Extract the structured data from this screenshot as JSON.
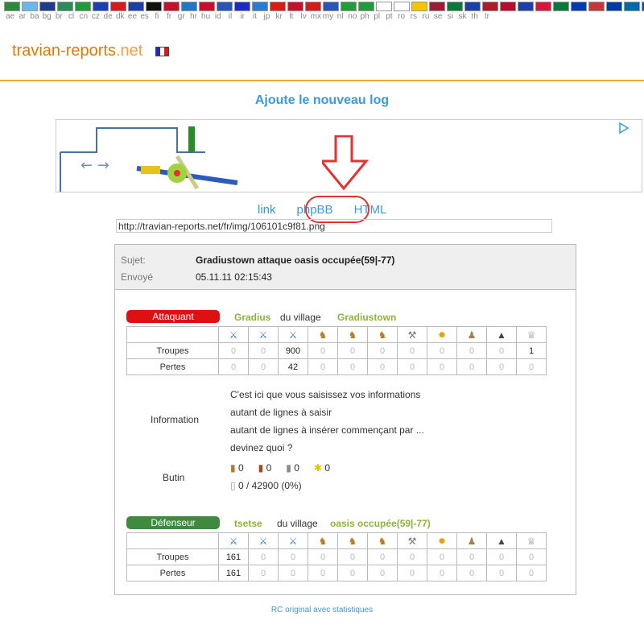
{
  "flags": {
    "codes": [
      "ae",
      "ar",
      "ba",
      "bg",
      "br",
      "cl",
      "cn",
      "cz",
      "de",
      "dk",
      "ee",
      "es",
      "fi",
      "fr",
      "gr",
      "hr",
      "hu",
      "id",
      "il",
      "ir",
      "it",
      "jp",
      "kr",
      "lt",
      "lv",
      "mx",
      "my",
      "nl",
      "no",
      "ph",
      "pl",
      "pt",
      "ro",
      "rs",
      "ru",
      "se",
      "si",
      "sk",
      "th",
      "tr"
    ],
    "colors": [
      "#2a8a3a",
      "#6fb5e6",
      "#1f3b8f",
      "#2e8b57",
      "#1e9c3c",
      "#1d3fb5",
      "#d71b1b",
      "#1a3fa8",
      "#111",
      "#c8102e",
      "#1e78c8",
      "#c8102e",
      "#2a55b6",
      "#1d2ac7",
      "#2f78d4",
      "#d71b1b",
      "#c8102e",
      "#d71b1b",
      "#2a55b6",
      "#239c3c",
      "#1e9c3c",
      "#ffffff",
      "#ffffff",
      "#f5c400",
      "#9e1b32",
      "#0a7a3a",
      "#1b3fa8",
      "#ae1c28",
      "#ba0c2f",
      "#1d3fa8",
      "#dc143c",
      "#0a7a3a",
      "#003da5",
      "#c6363c",
      "#0039a6",
      "#006aa7",
      "#0b4ea2",
      "#0b4ea2",
      "#2d2a4a",
      "#e30a17"
    ]
  },
  "site": {
    "name": "travian-reports",
    "tld": ".net"
  },
  "heading": "Ajoute le nouveau log",
  "tabs": [
    "link",
    "phpBB",
    "HTML"
  ],
  "url_value": "http://travian-reports.net/fr/img/106101c9f81.png",
  "report": {
    "subject_label": "Sujet:",
    "subject": "Gradiustown attaque oasis occupée(59|-77)‎",
    "sent_label": "Envoyé",
    "sent": "05.11.11 02:15:43",
    "attacker": {
      "role": "Attaquant",
      "name": "Gradius",
      "of_village": "du village",
      "village": "Gradiustown",
      "color": "#e01010",
      "unit_icons": [
        "sword-icon",
        "sword-icon",
        "sword-icon",
        "horse-icon",
        "horse-icon",
        "horse-icon",
        "ram-icon",
        "catapult-icon",
        "chief-icon",
        "settler-icon",
        "hero-icon"
      ],
      "rows": [
        {
          "label": "Troupes",
          "values": [
            "0",
            "0",
            "900",
            "0",
            "0",
            "0",
            "0",
            "0",
            "0",
            "0",
            "1"
          ]
        },
        {
          "label": "Pertes",
          "values": [
            "0",
            "0",
            "42",
            "0",
            "0",
            "0",
            "0",
            "0",
            "0",
            "0",
            "0"
          ]
        }
      ]
    },
    "information": {
      "label": "Information",
      "lines": [
        "C'est ici que vous saisissez vos informations",
        "autant de lignes à saisir",
        "autant de lignes à insérer commençant par ...",
        "devinez quoi ?"
      ]
    },
    "bounty": {
      "label": "Butin",
      "resources": [
        "0",
        "0",
        "0",
        "0"
      ],
      "capacity": "0 / 42900 (0%)"
    },
    "defender": {
      "role": "Défenseur",
      "name": "tsetse",
      "of_village": "du village",
      "village": "oasis occupée(59|-77)‎",
      "color": "#3f8a3f",
      "rows": [
        {
          "label": "Troupes",
          "values": [
            "161",
            "0",
            "0",
            "0",
            "0",
            "0",
            "0",
            "0",
            "0",
            "0",
            "0"
          ]
        },
        {
          "label": "Pertes",
          "values": [
            "161",
            "0",
            "0",
            "0",
            "0",
            "0",
            "0",
            "0",
            "0",
            "0",
            "0"
          ]
        }
      ]
    }
  },
  "rc_link": "RC original avec statistiques"
}
